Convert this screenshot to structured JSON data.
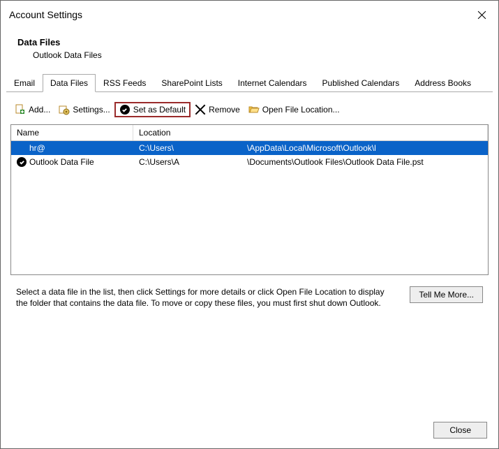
{
  "window": {
    "title": "Account Settings"
  },
  "header": {
    "title": "Data Files",
    "subtitle": "Outlook Data Files"
  },
  "tabs": [
    {
      "label": "Email",
      "active": false
    },
    {
      "label": "Data Files",
      "active": true
    },
    {
      "label": "RSS Feeds",
      "active": false
    },
    {
      "label": "SharePoint Lists",
      "active": false
    },
    {
      "label": "Internet Calendars",
      "active": false
    },
    {
      "label": "Published Calendars",
      "active": false
    },
    {
      "label": "Address Books",
      "active": false
    }
  ],
  "toolbar": {
    "add": "Add...",
    "settings": "Settings...",
    "set_default": "Set as Default",
    "remove": "Remove",
    "open_location": "Open File Location..."
  },
  "list": {
    "columns": {
      "name": "Name",
      "location": "Location"
    },
    "rows": [
      {
        "name": "hr@",
        "loc_a": "C:\\Users\\",
        "loc_b": "\\AppData\\Local\\Microsoft\\Outlook\\l",
        "default": false,
        "selected": true
      },
      {
        "name": "Outlook Data File",
        "loc_a": "C:\\Users\\A",
        "loc_b": "\\Documents\\Outlook Files\\Outlook Data File.pst",
        "default": true,
        "selected": false
      }
    ]
  },
  "hint": "Select a data file in the list, then click Settings for more details or click Open File Location to display the folder that contains the data file. To move or copy these files, you must first shut down Outlook.",
  "buttons": {
    "tell_me_more": "Tell Me More...",
    "close": "Close"
  }
}
